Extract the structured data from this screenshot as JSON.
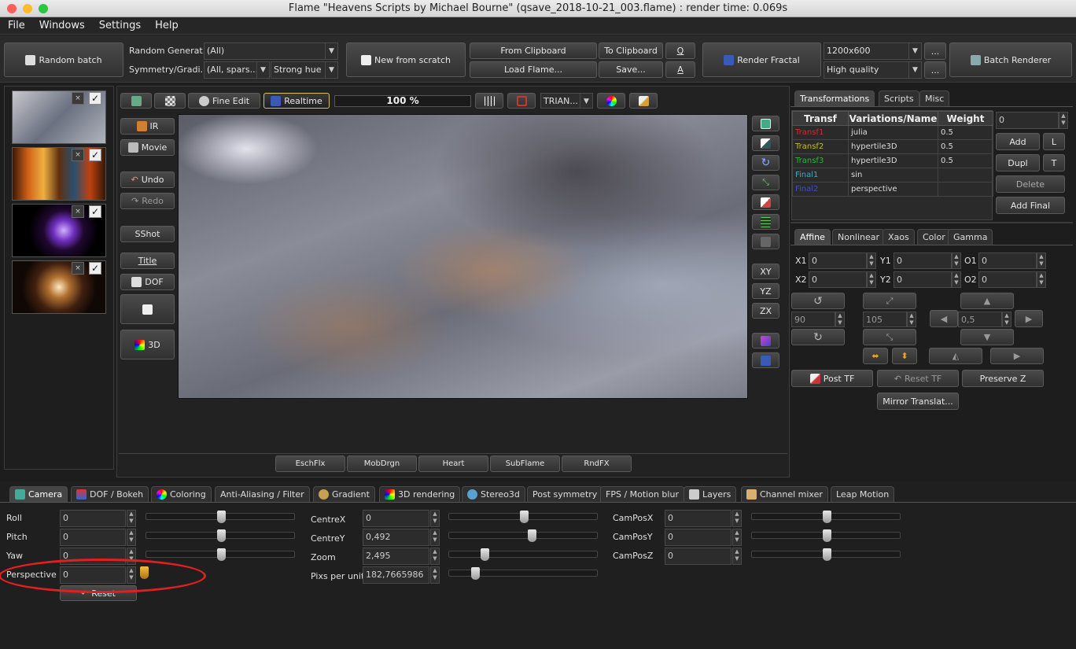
{
  "window": {
    "title": "Flame \"Heavens Scripts by Michael Bourne\" (qsave_2018-10-21_003.flame) : render time: 0.069s"
  },
  "menu": [
    "File",
    "Windows",
    "Settings",
    "Help"
  ],
  "toolbar": {
    "random_batch": "Random batch",
    "random_gen_label": "Random Generat...",
    "random_gen_value": "(All)",
    "symmetry_label": "Symmetry/Gradi...",
    "symmetry_value": "(All, spars...",
    "gradient_value": "Strong hue",
    "new_from_scratch": "New from scratch",
    "from_clipboard": "From Clipboard",
    "to_clipboard": "To Clipboard",
    "load_flame": "Load Flame...",
    "save": "Save...",
    "q": "Q",
    "a": "A",
    "render_fractal": "Render Fractal",
    "resolution": "1200x600",
    "quality": "High quality",
    "ellipsis": "...",
    "batch_renderer": "Batch Renderer"
  },
  "thumbnails": [
    {
      "x": "×",
      "chk": "✓"
    },
    {
      "x": "×",
      "chk": "✓"
    },
    {
      "x": "×",
      "chk": "✓"
    },
    {
      "x": "×",
      "chk": "✓"
    }
  ],
  "preview_toolbar": {
    "fine_edit": "Fine Edit",
    "realtime": "Realtime",
    "progress": "100 %",
    "mode": "TRIAN..."
  },
  "left_tools": {
    "ir": "IR",
    "movie": "Movie",
    "undo": "Undo",
    "redo": "Redo",
    "sshot": "SShot",
    "title": "Title",
    "dof": "DOF",
    "three_d": "3D"
  },
  "right_tools": {
    "xy": "XY",
    "yz": "YZ",
    "zx": "ZX"
  },
  "bottom_buttons": [
    "EschFlx",
    "MobDrgn",
    "Heart",
    "SubFlame",
    "RndFX"
  ],
  "right_panel": {
    "tabs": [
      "Transformations",
      "Scripts",
      "Misc"
    ],
    "columns": [
      "Transf",
      "Variations/Name",
      "Weight"
    ],
    "rows": [
      {
        "name": "Transf1",
        "var": "julia",
        "weight": "0.5",
        "color": "#c83030"
      },
      {
        "name": "Transf2",
        "var": "hypertile3D",
        "weight": "0.5",
        "color": "#c8b830"
      },
      {
        "name": "Transf3",
        "var": "hypertile3D",
        "weight": "0.5",
        "color": "#30b040"
      },
      {
        "name": "Final1",
        "var": "sin",
        "weight": "",
        "color": "#40a8c8"
      },
      {
        "name": "Final2",
        "var": "perspective",
        "weight": "",
        "color": "#4050c8"
      }
    ],
    "weight_value": "0",
    "add": "Add",
    "l": "L",
    "dupl": "Dupl",
    "t": "T",
    "delete": "Delete",
    "add_final": "Add Final",
    "sub_tabs": [
      "Affine",
      "Nonlinear",
      "Xaos",
      "Color",
      "Gamma"
    ],
    "x1": "X1",
    "y1": "Y1",
    "o1": "O1",
    "x2": "X2",
    "y2": "Y2",
    "o2": "O2",
    "x1v": "0",
    "y1v": "0",
    "o1v": "0",
    "x2v": "0",
    "y2v": "0",
    "o2v": "0",
    "rot_value": "90",
    "scale_value": "105",
    "move_value": "0,5",
    "post_tf": "Post TF",
    "reset_tf": "Reset TF",
    "preserve_z": "Preserve Z",
    "mirror": "Mirror Translat..."
  },
  "bottom_tabs": [
    "Camera",
    "DOF / Bokeh",
    "Coloring",
    "Anti-Aliasing / Filter",
    "Gradient",
    "3D rendering",
    "Stereo3d",
    "Post symmetry",
    "FPS / Motion blur",
    "Layers",
    "Channel mixer",
    "Leap Motion"
  ],
  "camera": {
    "roll": "Roll",
    "roll_v": "0",
    "pitch": "Pitch",
    "pitch_v": "0",
    "yaw": "Yaw",
    "yaw_v": "0",
    "perspective": "Perspective",
    "perspective_v": "0",
    "reset": "Reset",
    "centrex": "CentreX",
    "centrex_v": "0",
    "centrey": "CentreY",
    "centrey_v": "0,492",
    "zoom": "Zoom",
    "zoom_v": "2,495",
    "pixs": "Pixs per unit",
    "pixs_v": "182,7665986",
    "camposx": "CamPosX",
    "camposx_v": "0",
    "camposy": "CamPosY",
    "camposy_v": "0",
    "camposz": "CamPosZ",
    "camposz_v": "0"
  },
  "colors": {
    "highlight_ellipse": "#e02020",
    "accent": "#d0c060"
  }
}
